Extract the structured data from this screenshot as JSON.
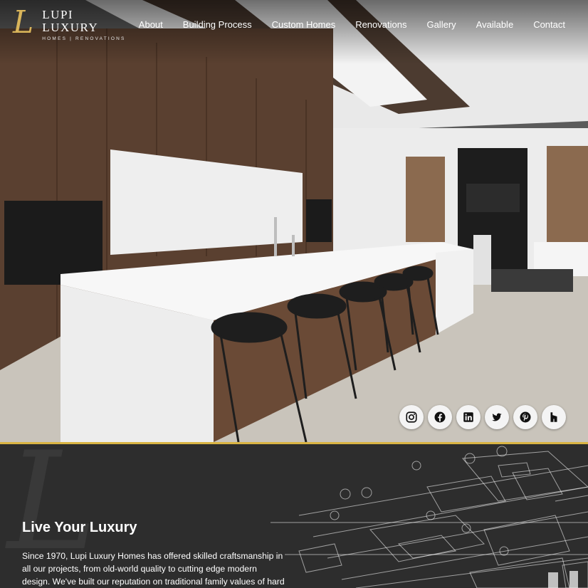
{
  "brand": {
    "monogram": "L",
    "name": "LUPI LUXURY",
    "tagline": "HOMES | RENOVATIONS"
  },
  "nav": {
    "items": [
      {
        "label": "About"
      },
      {
        "label": "Building Process"
      },
      {
        "label": "Custom Homes"
      },
      {
        "label": "Renovations"
      },
      {
        "label": "Gallery"
      },
      {
        "label": "Available"
      },
      {
        "label": "Contact"
      }
    ]
  },
  "hero": {
    "image": "modern-kitchen-photo"
  },
  "social": [
    {
      "icon": "instagram-icon"
    },
    {
      "icon": "facebook-icon"
    },
    {
      "icon": "linkedin-icon"
    },
    {
      "icon": "twitter-icon"
    },
    {
      "icon": "pinterest-icon"
    },
    {
      "icon": "houzz-icon"
    }
  ],
  "intro": {
    "watermark": "L",
    "heading": "Live Your Luxury",
    "paragraph": "Since 1970, Lupi Luxury Homes has offered skilled craftsmanship in all our projects, from old-world quality to cutting edge modern design. We've built our reputation on traditional family values of hard work,"
  },
  "colors": {
    "accent": "#d9b443",
    "dark_bg": "#2d2d2d",
    "nav_text": "#ffffff"
  }
}
